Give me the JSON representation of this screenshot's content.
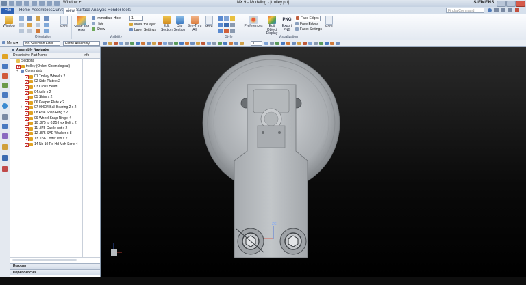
{
  "window": {
    "title": "NX 9 - Modeling - [trolley.prt]",
    "brand": "SIEMENS",
    "quick_access": "Window",
    "quick_access_suffix": "+"
  },
  "menu_tabs": [
    "File",
    "Home",
    "Assemblies",
    "Curve",
    "View",
    "Surface",
    "Analysis",
    "Render",
    "Tools"
  ],
  "active_tab": "View",
  "find_command": {
    "placeholder": "Find a Command"
  },
  "ribbon": {
    "window_label": "Window",
    "orientation_label": "Orientation",
    "more_label_1": "More",
    "show_hide_label": "Show and Hide",
    "immediate_hide": "Immediate Hide",
    "hide": "Hide",
    "show": "Show",
    "layer_number": "1",
    "move_to_layer": "Move to Layer",
    "layer_settings": "Layer Settings",
    "visibility_label": "Visibility",
    "edit_section": "Edit Section",
    "clip_section": "Clip Section",
    "see_thru_all": "See-Thru All",
    "more_label_2": "More",
    "style_label": "Style",
    "preferences": "Preferences",
    "edit_object_display": "Edit Object Display",
    "export_png": "Export PNG",
    "png_badge": "PNG",
    "face_edges_on": "Face Edges",
    "face_edges": "Face Edges",
    "facet_settings": "Facet Settings",
    "visualization_label": "Visualization",
    "more_label_3": "More"
  },
  "selection_bar": {
    "menu": "Menu",
    "filter": "No Selection Filter",
    "scope": "Entire Assembly",
    "layer_value": "1"
  },
  "navigator": {
    "title": "Assembly Navigator",
    "columns": [
      "Descriptive Part Name",
      "Info"
    ],
    "items": [
      {
        "label": "Sections",
        "indent": 0,
        "type": "folder"
      },
      {
        "label": "trolley (Order: Chronological)",
        "indent": 0,
        "type": "assembly"
      },
      {
        "label": "Constraints",
        "indent": 1,
        "type": "constraints"
      },
      {
        "label": "01 Trolley Wheel x 2",
        "indent": 2,
        "type": "part"
      },
      {
        "label": "02 Side Plate x 2",
        "indent": 2,
        "type": "part"
      },
      {
        "label": "03 Cross Head",
        "indent": 2,
        "type": "part"
      },
      {
        "label": "04 Axle x 2",
        "indent": 2,
        "type": "part"
      },
      {
        "label": "05 Shim x 2",
        "indent": 2,
        "type": "part"
      },
      {
        "label": "06 Keeper Plate x 2",
        "indent": 2,
        "type": "part"
      },
      {
        "label": "07 99604 Ball Bearing 2 x 2",
        "indent": 2,
        "type": "subassembly"
      },
      {
        "label": "08 Axle Snap Ring x 2",
        "indent": 2,
        "type": "part"
      },
      {
        "label": "09 Wheel Snap Ring x 4",
        "indent": 2,
        "type": "part"
      },
      {
        "label": "10 .875 to 0.25 Hex Bolt x 2",
        "indent": 2,
        "type": "part"
      },
      {
        "label": "11 .875 Castle nut x 2",
        "indent": 2,
        "type": "part"
      },
      {
        "label": "12 .875 SAE Washer x 8",
        "indent": 2,
        "type": "part"
      },
      {
        "label": "13 .156 Cotter Pin x 2",
        "indent": 2,
        "type": "part"
      },
      {
        "label": "14 No 10 Rd Hd Mch Scr x 4",
        "indent": 2,
        "type": "part"
      }
    ],
    "panels": [
      "Preview",
      "Dependencies"
    ]
  },
  "viewport": {
    "triad_label": "ZC",
    "background_top": "#2b2b2b",
    "background_bottom": "#000000",
    "part_color": "#b8bcbf"
  },
  "colors": {
    "file_tab": "#2f63b5",
    "checkbox": "#c42e2e",
    "part_icon": "#e0a323"
  }
}
